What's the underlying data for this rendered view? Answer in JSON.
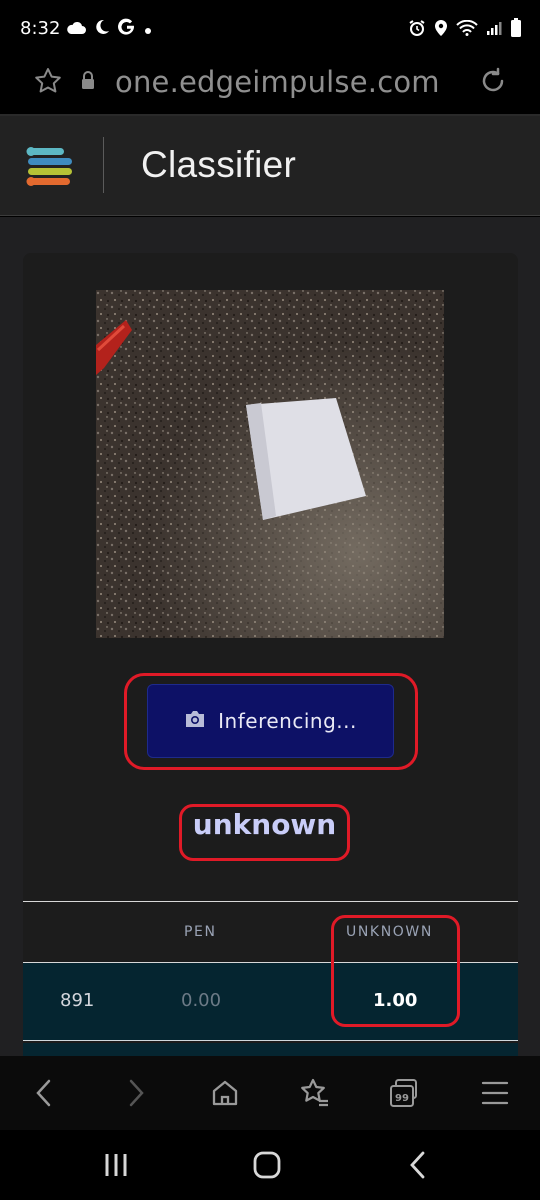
{
  "status_bar": {
    "time": "8:32",
    "left_icons": [
      "cloud-icon",
      "moon-icon",
      "google-icon",
      "dot-icon"
    ],
    "right_icons": [
      "alarm-icon",
      "location-icon",
      "wifi-icon",
      "signal-icon",
      "battery-icon"
    ]
  },
  "browser": {
    "url": "one.edgeimpulse.com",
    "toolbar": [
      "back-icon",
      "forward-icon",
      "home-icon",
      "bookmarks-icon",
      "tabs-icon",
      "menu-icon"
    ],
    "tab_count": "99"
  },
  "app": {
    "title": "Classifier"
  },
  "classifier": {
    "button_label": "Inferencing...",
    "result": "unknown",
    "table": {
      "headers": [
        "",
        "PEN",
        "UNKNOWN"
      ],
      "rows": [
        {
          "id": "891",
          "pen": "0.00",
          "unknown": "1.00"
        }
      ]
    }
  },
  "colors": {
    "accent_button": "#0d1166",
    "highlight_outline": "#e01a27",
    "row_background": "#052530"
  },
  "android_nav": [
    "recents-icon",
    "home-icon",
    "back-icon"
  ]
}
